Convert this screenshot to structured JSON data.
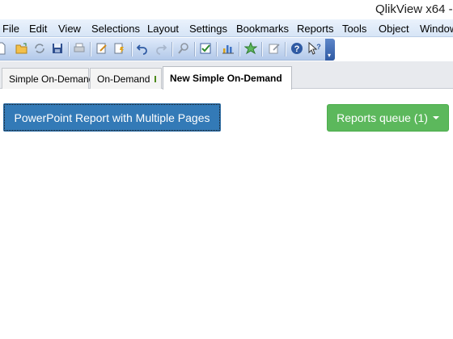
{
  "window": {
    "title": "QlikView x64 -"
  },
  "menu": [
    "File",
    "Edit",
    "View",
    "Selections",
    "Layout",
    "Settings",
    "Bookmarks",
    "Reports",
    "Tools",
    "Object",
    "Window"
  ],
  "toolbar": {
    "icons": [
      "new-document-icon",
      "open-folder-icon",
      "reload-icon",
      "save-icon",
      "print-icon",
      "edit-script-icon",
      "reload-data-icon",
      "undo-icon",
      "redo-icon",
      "search-icon",
      "checkbox-icon",
      "chart-icon",
      "star-icon",
      "edit-icon",
      "help-icon",
      "whats-this-icon"
    ],
    "overflow_glyph": "▾"
  },
  "tabs": [
    {
      "label": "Simple On-Demand"
    },
    {
      "label": "On-Demand",
      "status_color": "#8cc63f"
    },
    {
      "label": "New Simple On-Demand"
    }
  ],
  "sheet": {
    "report_button": "PowerPoint Report with Multiple Pages",
    "queue_button": "Reports queue (1)"
  },
  "colors": {
    "primary_button": "#337ab7",
    "success_button": "#5cb85c",
    "menubar": "#dce8f7"
  }
}
